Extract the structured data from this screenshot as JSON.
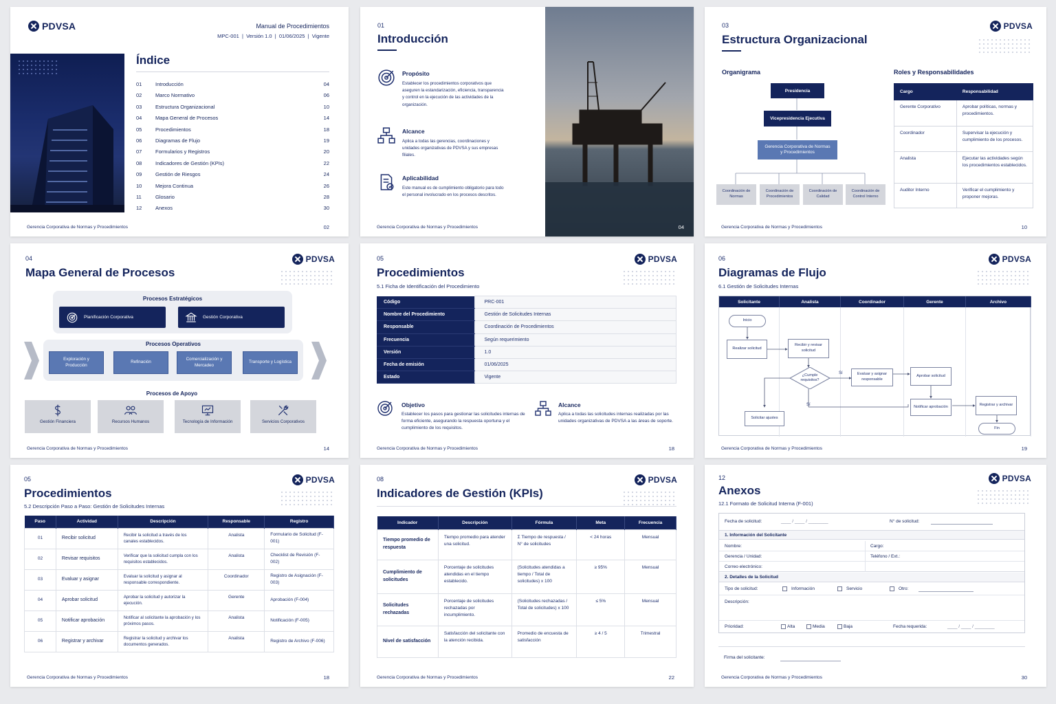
{
  "brand": "PDVSA",
  "footer": "Gerencia Corporativa de Normas y Procedimientos",
  "p1": {
    "manual_title": "Manual de Procedimientos",
    "meta": "MPC-001  |  Versión 1.0  |  01/06/2025  |  Vigente",
    "title": "Índice",
    "items": [
      {
        "n": "01",
        "label": "Introducción",
        "page": "04"
      },
      {
        "n": "02",
        "label": "Marco Normativo",
        "page": "06"
      },
      {
        "n": "03",
        "label": "Estructura Organizacional",
        "page": "10"
      },
      {
        "n": "04",
        "label": "Mapa General de Procesos",
        "page": "14"
      },
      {
        "n": "05",
        "label": "Procedimientos",
        "page": "18"
      },
      {
        "n": "06",
        "label": "Diagramas de Flujo",
        "page": "19"
      },
      {
        "n": "07",
        "label": "Formularios y Registros",
        "page": "20"
      },
      {
        "n": "08",
        "label": "Indicadores de Gestión (KPIs)",
        "page": "22"
      },
      {
        "n": "09",
        "label": "Gestión de Riesgos",
        "page": "24"
      },
      {
        "n": "10",
        "label": "Mejora Continua",
        "page": "26"
      },
      {
        "n": "11",
        "label": "Glosario",
        "page": "28"
      },
      {
        "n": "12",
        "label": "Anexos",
        "page": "30"
      }
    ],
    "page_num": "02"
  },
  "p2": {
    "num": "01",
    "title": "Introducción",
    "blocks": [
      {
        "title": "Propósito",
        "text": "Establecer los procedimientos corporativos que aseguren la estandarización, eficiencia, transparencia y control en la ejecución de las actividades de la organización.",
        "icon": "target-icon"
      },
      {
        "title": "Alcance",
        "text": "Aplica a todas las gerencias, coordinaciones y unidades organizativas de PDVSA y sus empresas filiales.",
        "icon": "org-chart-icon"
      },
      {
        "title": "Aplicabilidad",
        "text": "Este manual es de cumplimiento obligatorio para todo el personal involucrado en los procesos descritos.",
        "icon": "document-check-icon"
      }
    ],
    "page_num": "04"
  },
  "p3": {
    "num": "03",
    "title": "Estructura Organizacional",
    "org_heading": "Organigrama",
    "org": {
      "top": "Presidencia",
      "vp": "Vicepresidencia Ejecutiva",
      "mgr": "Gerencia Corporativa de Normas y Procedimientos",
      "leaves": [
        "Coordinación de Normas",
        "Coordinación de Procedimientos",
        "Coordinación de Calidad",
        "Coordinación de Control Interno"
      ]
    },
    "roles_heading": "Roles y Responsabilidades",
    "roles_cols": [
      "Cargo",
      "Responsabilidad"
    ],
    "roles": [
      [
        "Gerente Corporativo",
        "Aprobar políticas, normas y procedimientos."
      ],
      [
        "Coordinador",
        "Supervisar la ejecución y cumplimiento de los procesos."
      ],
      [
        "Analista",
        "Ejecutar las actividades según los procedimientos establecidos."
      ],
      [
        "Auditor Interno",
        "Verificar el cumplimiento y proponer mejoras."
      ]
    ],
    "page_num": "10"
  },
  "p4": {
    "num": "04",
    "title": "Mapa General de Procesos",
    "strategic_title": "Procesos Estratégicos",
    "strategic": [
      "Planificación Corporativa",
      "Gestión Corporativa"
    ],
    "operative_title": "Procesos Operativos",
    "operative": [
      "Exploración y Producción",
      "Refinación",
      "Comercialización y Mercadeo",
      "Transporte y Logística"
    ],
    "support_title": "Procesos de Apoyo",
    "support": [
      {
        "label": "Gestión Financiera",
        "icon": "dollar-icon"
      },
      {
        "label": "Recursos Humanos",
        "icon": "people-icon"
      },
      {
        "label": "Tecnología de Información",
        "icon": "monitor-icon"
      },
      {
        "label": "Servicios Corporativos",
        "icon": "tools-icon"
      }
    ],
    "page_num": "14"
  },
  "p5": {
    "num": "05",
    "title": "Procedimientos",
    "sub": "5.1 Ficha de Identificación del Procedimiento",
    "rows": [
      [
        "Código",
        "PRC-001"
      ],
      [
        "Nombre del Procedimiento",
        "Gestión de Solicitudes Internas"
      ],
      [
        "Responsable",
        "Coordinación de Procedimientos"
      ],
      [
        "Frecuencia",
        "Según requerimiento"
      ],
      [
        "Versión",
        "1.0"
      ],
      [
        "Fecha de emisión",
        "01/06/2025"
      ],
      [
        "Estado",
        "Vigente"
      ]
    ],
    "objective_title": "Objetivo",
    "objective_text": "Establecer los pasos para gestionar las solicitudes internas de forma eficiente, asegurando la respuesta oportuna y el cumplimiento de los requisitos.",
    "scope_title": "Alcance",
    "scope_text": "Aplica a todas las solicitudes internas realizadas por las unidades organizativas de PDVSA a las áreas de soporte.",
    "page_num": "18"
  },
  "p6": {
    "num": "06",
    "title": "Diagramas de Flujo",
    "sub": "6.1 Gestión de Solicitudes Internas",
    "lanes": [
      "Solicitante",
      "Analista",
      "Coordinador",
      "Gerente",
      "Archivo"
    ],
    "nodes": {
      "start": "Inicio",
      "submit": "Realizar solicitud",
      "review": "Recibir y revisar solicitud",
      "decision": "¿Cumple requisitos?",
      "adjust": "Solicitar ajustes",
      "assign": "Evaluar y asignar responsable",
      "approve": "Aprobar solicitud",
      "notify": "Notificar aprobación",
      "archive": "Registrar y archivar",
      "end": "Fin",
      "yes": "Sí",
      "no": "Sí"
    },
    "page_num": "19"
  },
  "p7": {
    "num": "05",
    "title": "Procedimientos",
    "sub": "5.2 Descripción Paso a Paso: Gestión de Solicitudes Internas",
    "cols": [
      "Paso",
      "Actividad",
      "Descripción",
      "Responsable",
      "Registro"
    ],
    "rows": [
      [
        "01",
        "Recibir solicitud",
        "Recibir la solicitud a través de los canales establecidos.",
        "Analista",
        "Formulario de Solicitud (F-001)"
      ],
      [
        "02",
        "Revisar requisitos",
        "Verificar que la solicitud cumpla con los requisitos establecidos.",
        "Analista",
        "Checklist de Revisión (F-002)"
      ],
      [
        "03",
        "Evaluar y asignar",
        "Evaluar la solicitud y asignar al responsable correspondiente.",
        "Coordinador",
        "Registro de Asignación (F-003)"
      ],
      [
        "04",
        "Aprobar solicitud",
        "Aprobar la solicitud y autorizar la ejecución.",
        "Gerente",
        "Aprobación (F-004)"
      ],
      [
        "05",
        "Notificar aprobación",
        "Notificar al solicitante la aprobación y los próximos pasos.",
        "Analista",
        "Notificación (F-005)"
      ],
      [
        "06",
        "Registrar y archivar",
        "Registrar la solicitud y archivar los documentos generados.",
        "Analista",
        "Registro de Archivo (F-006)"
      ]
    ],
    "page_num": "18"
  },
  "p8": {
    "num": "08",
    "title": "Indicadores de Gestión (KPIs)",
    "cols": [
      "Indicador",
      "Descripción",
      "Fórmula",
      "Meta",
      "Frecuencia"
    ],
    "rows": [
      [
        "Tiempo promedio de respuesta",
        "Tiempo promedio para atender una solicitud.",
        "Σ Tiempo de respuesta / N° de solicitudes",
        "< 24 horas",
        "Mensual"
      ],
      [
        "Cumplimiento de solicitudes",
        "Porcentaje de solicitudes atendidas en el tiempo establecido.",
        "(Solicitudes atendidas a tiempo / Total de solicitudes) x 100",
        "≥ 95%",
        "Mensual"
      ],
      [
        "Solicitudes rechazadas",
        "Porcentaje de solicitudes rechazadas por incumplimiento.",
        "(Solicitudes rechazadas / Total de solicitudes) x 100",
        "≤ 5%",
        "Mensual"
      ],
      [
        "Nivel de satisfacción",
        "Satisfacción del solicitante con la atención recibida.",
        "Promedio de encuesta de satisfacción",
        "≥ 4 / 5",
        "Trimestral"
      ]
    ],
    "page_num": "22"
  },
  "p9": {
    "num": "12",
    "title": "Anexos",
    "sub": "12.1 Formato de Solicitud Interna (F-001)",
    "date_label": "Fecha de solicitud:",
    "date_blank": "____ / ____ / ________",
    "req_no_label": "N° de solicitud:",
    "s1": "1. Información del Solicitante",
    "name_label": "Nombre:",
    "role_label": "Cargo:",
    "dept_label": "Gerencia / Unidad:",
    "phone_label": "Teléfono / Ext.:",
    "email_label": "Correo electrónico:",
    "s2": "2. Detalles de la Solicitud",
    "type_label": "Tipo de solicitud:",
    "type_opts": [
      "Información",
      "Servicio",
      "Otro:"
    ],
    "desc_label": "Descripción:",
    "prio_label": "Prioridad:",
    "prio_opts": [
      "Alta",
      "Media",
      "Baja"
    ],
    "req_date_label": "Fecha requerida:",
    "req_date_blank": "____ / ____ / ________",
    "sign_label": "Firma del solicitante:",
    "page_num": "30"
  }
}
